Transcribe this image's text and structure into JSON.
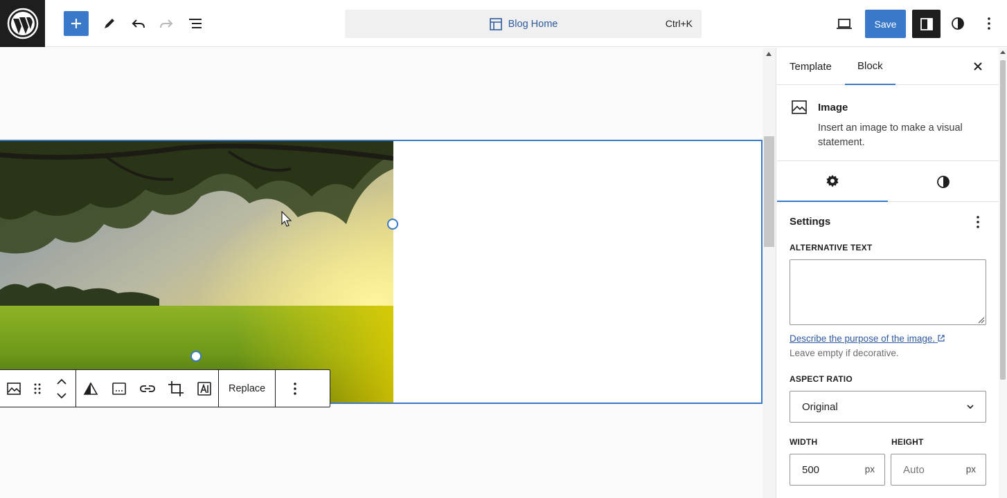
{
  "header": {
    "document_title": "Blog Home",
    "shortcut": "Ctrl+K",
    "save_label": "Save"
  },
  "toolbar_icons": [
    "wordpress-logo",
    "plus-icon",
    "pencil-icon",
    "undo-icon",
    "redo-icon",
    "list-view-icon",
    "layout-icon",
    "desktop-view-icon",
    "sidebar-toggle-icon",
    "styles-icon",
    "more-vertical-icon"
  ],
  "block_toolbar": {
    "replace_label": "Replace"
  },
  "sidebar": {
    "tabs": [
      {
        "label": "Template"
      },
      {
        "label": "Block"
      }
    ],
    "active_tab": "Block",
    "block_card": {
      "title": "Image",
      "description": "Insert an image to make a visual statement."
    },
    "panel": {
      "title": "Settings",
      "alt_text_label": "ALTERNATIVE TEXT",
      "alt_text_value": "",
      "help_link": "Describe the purpose of the image.",
      "help_text": "Leave empty if decorative.",
      "aspect_ratio_label": "ASPECT RATIO",
      "aspect_ratio_value": "Original",
      "width_label": "WIDTH",
      "width_value": "500",
      "width_unit": "px",
      "height_label": "HEIGHT",
      "height_placeholder": "Auto",
      "height_unit": "px"
    }
  },
  "colors": {
    "accent": "#3a79c9",
    "dark": "#1e1e1e"
  }
}
